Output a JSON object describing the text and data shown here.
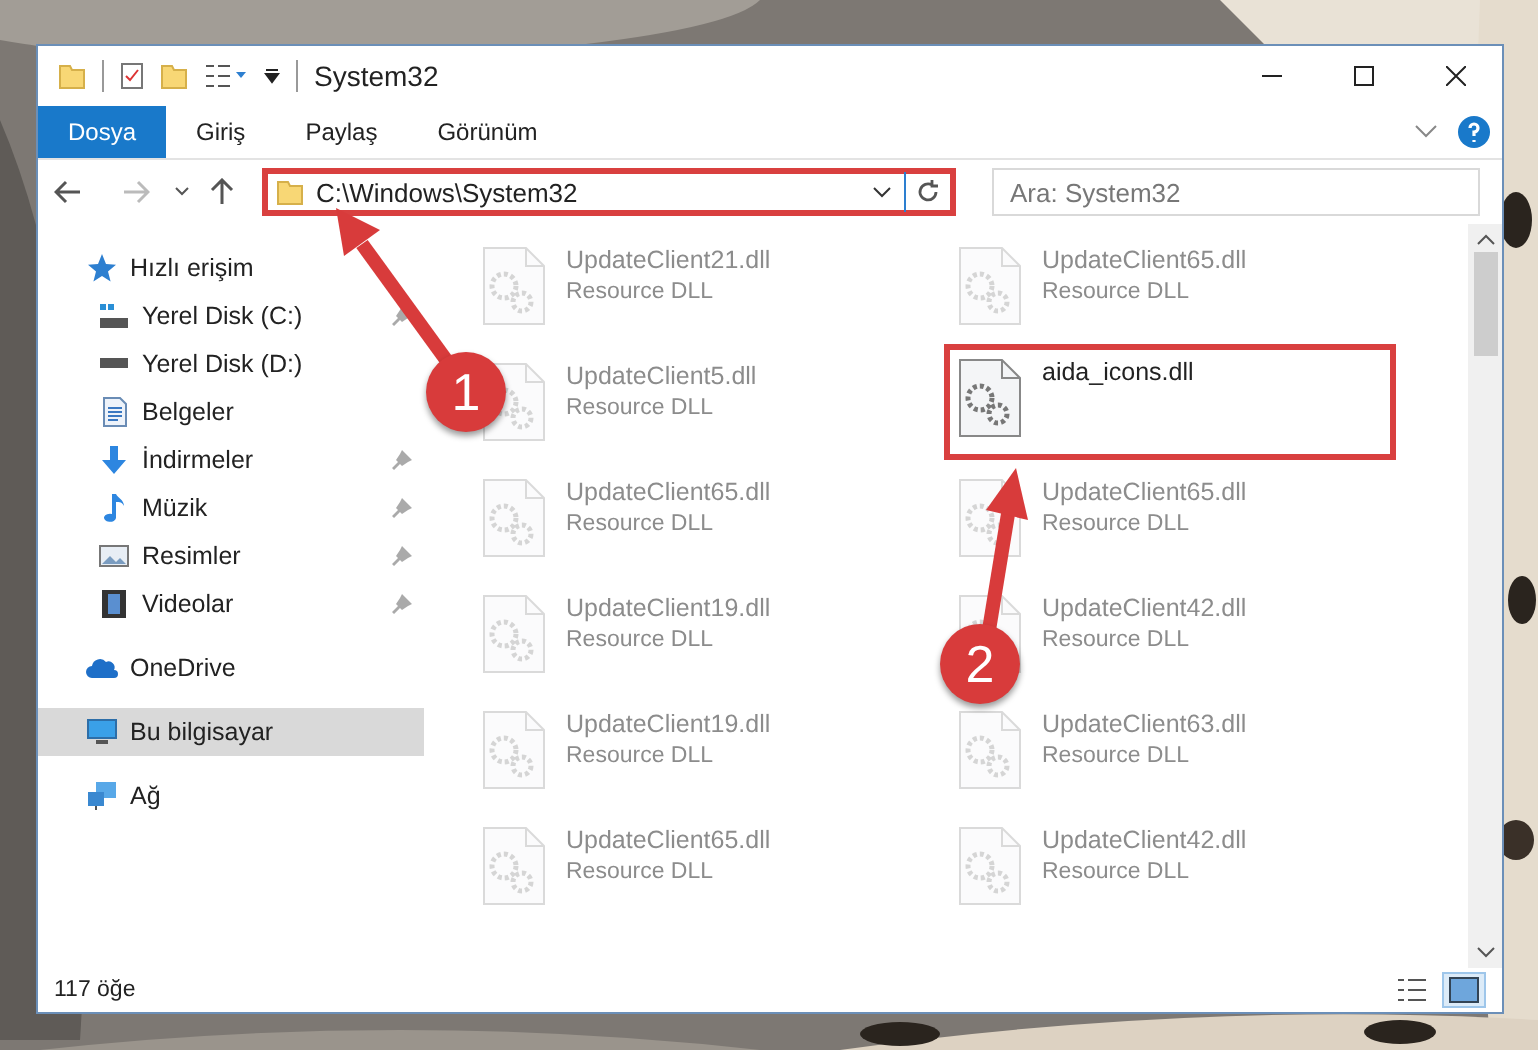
{
  "window": {
    "title": "System32"
  },
  "ribbon_tabs": [
    {
      "label": "Dosya",
      "selected": true
    },
    {
      "label": "Giriş",
      "selected": false
    },
    {
      "label": "Paylaş",
      "selected": false
    },
    {
      "label": "Görünüm",
      "selected": false
    }
  ],
  "address": {
    "path": "C:\\Windows\\System32",
    "marked": true
  },
  "search": {
    "placeholder": "Ara: System32"
  },
  "sidebar": {
    "items": [
      {
        "label": "Hızlı erişim",
        "kind": "star",
        "selected": false,
        "children": [
          {
            "label": "Yerel Disk (C:)",
            "kind": "systemdrive",
            "pinned": true,
            "selected": false
          },
          {
            "label": "Yerel Disk (D:)",
            "kind": "drive",
            "pinned": false,
            "selected": false
          },
          {
            "label": "Belgeler",
            "kind": "documents",
            "pinned": false,
            "selected": false
          },
          {
            "label": "İndirmeler",
            "kind": "downloads",
            "pinned": true,
            "selected": false
          },
          {
            "label": "Müzik",
            "kind": "music",
            "pinned": true,
            "selected": false
          },
          {
            "label": "Resimler",
            "kind": "pictures",
            "pinned": true,
            "selected": false
          },
          {
            "label": "Videolar",
            "kind": "videos",
            "pinned": true,
            "selected": false
          }
        ]
      },
      {
        "label": "OneDrive",
        "kind": "cloud",
        "selected": false
      },
      {
        "label": "Bu bilgisayar",
        "kind": "computer",
        "selected": true
      },
      {
        "label": "Ağ",
        "kind": "network",
        "selected": false
      }
    ]
  },
  "files": [
    {
      "name": "UpdateClient21.dll",
      "type": "Resource DLL",
      "dimmed": true,
      "marked": false
    },
    {
      "name": "UpdateClient65.dll",
      "type": "Resource DLL",
      "dimmed": true,
      "marked": false
    },
    {
      "name": "UpdateClient5.dll",
      "type": "Resource DLL",
      "dimmed": true,
      "marked": false
    },
    {
      "name": "aida_icons.dll",
      "dimmed": false,
      "marked": true
    },
    {
      "name": "UpdateClient65.dll",
      "type": "Resource DLL",
      "dimmed": true,
      "marked": false
    },
    {
      "name": "UpdateClient65.dll",
      "type": "Resource DLL",
      "dimmed": true,
      "marked": false
    },
    {
      "name": "UpdateClient19.dll",
      "type": "Resource DLL",
      "dimmed": true,
      "marked": false
    },
    {
      "name": "UpdateClient42.dll",
      "type": "Resource DLL",
      "dimmed": true,
      "marked": false
    },
    {
      "name": "UpdateClient19.dll",
      "type": "Resource DLL",
      "dimmed": true,
      "marked": false
    },
    {
      "name": "UpdateClient63.dll",
      "type": "Resource DLL",
      "dimmed": true,
      "marked": false
    },
    {
      "name": "UpdateClient65.dll",
      "type": "Resource DLL",
      "dimmed": true,
      "marked": false
    },
    {
      "name": "UpdateClient42.dll",
      "type": "Resource DLL",
      "dimmed": true,
      "marked": false
    }
  ],
  "status_bar": {
    "count": "117 öğe"
  },
  "view_buttons": [
    {
      "kind": "details",
      "selected": false
    },
    {
      "kind": "large",
      "selected": true
    }
  ],
  "annotations": [
    {
      "number": "1"
    },
    {
      "number": "2"
    }
  ]
}
